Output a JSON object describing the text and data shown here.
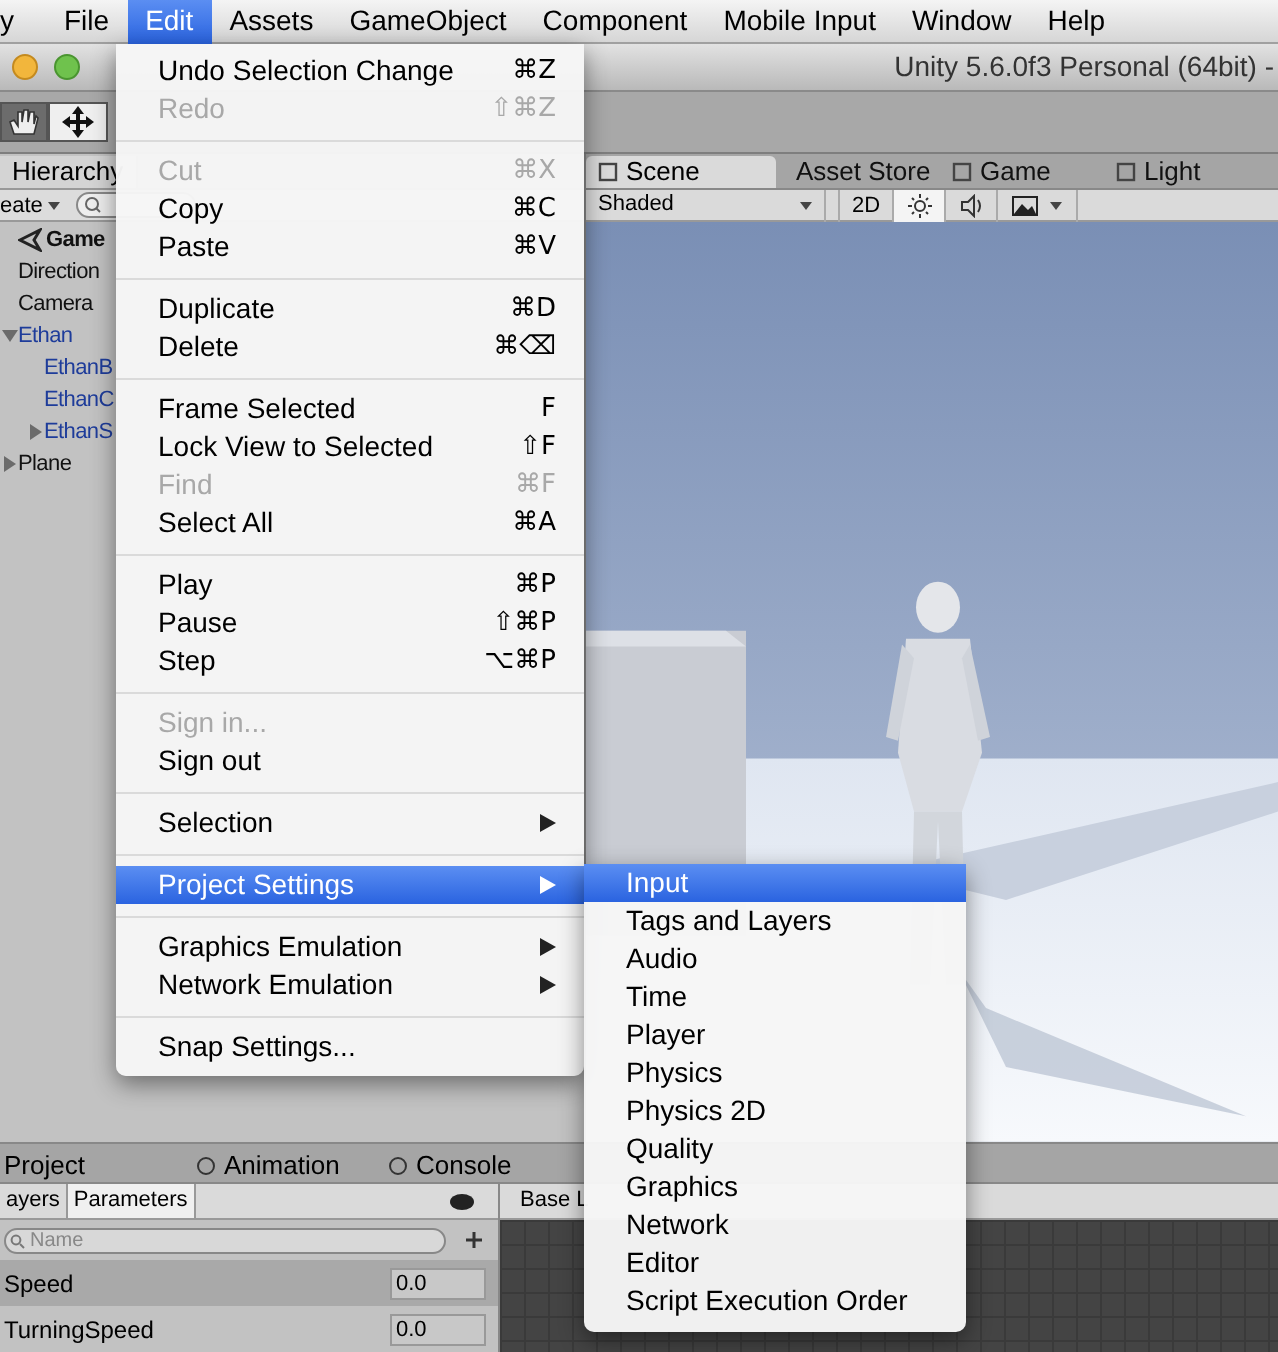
{
  "menubar": {
    "items": [
      {
        "label": "y",
        "selected": false
      },
      {
        "label": "File",
        "selected": false
      },
      {
        "label": "Edit",
        "selected": true
      },
      {
        "label": "Assets",
        "selected": false
      },
      {
        "label": "GameObject",
        "selected": false
      },
      {
        "label": "Component",
        "selected": false
      },
      {
        "label": "Mobile Input",
        "selected": false
      },
      {
        "label": "Window",
        "selected": false
      },
      {
        "label": "Help",
        "selected": false
      }
    ]
  },
  "window": {
    "title": "Unity 5.6.0f3 Personal (64bit) -"
  },
  "hierarchy": {
    "tab": "Hierarchy",
    "create_button": "eate",
    "tree": [
      {
        "label": "Game",
        "bold": true,
        "children": [
          {
            "label": "Direction"
          },
          {
            "label": "Camera"
          },
          {
            "label": "Ethan",
            "prefab": true,
            "expanded": true,
            "children": [
              {
                "label": "EthanB",
                "prefab": true
              },
              {
                "label": "EthanC",
                "prefab": true
              },
              {
                "label": "EthanS",
                "prefab": true,
                "expanded": false
              }
            ]
          },
          {
            "label": "Plane",
            "expanded": false
          }
        ]
      }
    ]
  },
  "scene": {
    "tabs": [
      {
        "label": "Scene",
        "selected": true
      },
      {
        "label": "Asset Store",
        "selected": false
      },
      {
        "label": "Game",
        "selected": false
      },
      {
        "label": "Light",
        "selected": false
      }
    ],
    "draw_mode": "Shaded",
    "mode_button": "2D"
  },
  "bottom": {
    "tabs": [
      {
        "label": "Project",
        "selected": false
      },
      {
        "label": "Animation",
        "selected": false
      },
      {
        "label": "Console",
        "selected": false
      }
    ],
    "sub_tabs": [
      {
        "label": "ayers",
        "selected": false
      },
      {
        "label": "Parameters",
        "selected": true
      }
    ],
    "search": {
      "placeholder": "Name"
    },
    "parameters": [
      {
        "name": "Speed",
        "value": "0.0",
        "selected": true
      },
      {
        "name": "TurningSpeed",
        "value": "0.0",
        "selected": false
      }
    ],
    "layer_tab": "Base L"
  },
  "edit_menu": {
    "items": [
      {
        "kind": "item",
        "label": "Undo Selection Change",
        "shortcut": "⌘Z",
        "disabled": false
      },
      {
        "kind": "item",
        "label": "Redo",
        "shortcut": "⇧⌘Z",
        "disabled": true
      },
      {
        "kind": "separator"
      },
      {
        "kind": "item",
        "label": "Cut",
        "shortcut": "⌘X",
        "disabled": true
      },
      {
        "kind": "item",
        "label": "Copy",
        "shortcut": "⌘C",
        "disabled": false
      },
      {
        "kind": "item",
        "label": "Paste",
        "shortcut": "⌘V",
        "disabled": false
      },
      {
        "kind": "separator"
      },
      {
        "kind": "item",
        "label": "Duplicate",
        "shortcut": "⌘D",
        "disabled": false
      },
      {
        "kind": "item",
        "label": "Delete",
        "shortcut": "⌘⌫",
        "disabled": false
      },
      {
        "kind": "separator"
      },
      {
        "kind": "item",
        "label": "Frame Selected",
        "shortcut": "F",
        "disabled": false
      },
      {
        "kind": "item",
        "label": "Lock View to Selected",
        "shortcut": "⇧F",
        "disabled": false
      },
      {
        "kind": "item",
        "label": "Find",
        "shortcut": "⌘F",
        "disabled": true
      },
      {
        "kind": "item",
        "label": "Select All",
        "shortcut": "⌘A",
        "disabled": false
      },
      {
        "kind": "separator"
      },
      {
        "kind": "item",
        "label": "Play",
        "shortcut": "⌘P",
        "disabled": false
      },
      {
        "kind": "item",
        "label": "Pause",
        "shortcut": "⇧⌘P",
        "disabled": false
      },
      {
        "kind": "item",
        "label": "Step",
        "shortcut": "⌥⌘P",
        "disabled": false
      },
      {
        "kind": "separator"
      },
      {
        "kind": "item",
        "label": "Sign in...",
        "disabled": true
      },
      {
        "kind": "item",
        "label": "Sign out",
        "disabled": false
      },
      {
        "kind": "separator"
      },
      {
        "kind": "submenu",
        "label": "Selection",
        "selected": false
      },
      {
        "kind": "separator"
      },
      {
        "kind": "submenu",
        "label": "Project Settings",
        "selected": true
      },
      {
        "kind": "separator"
      },
      {
        "kind": "submenu",
        "label": "Graphics Emulation",
        "selected": false
      },
      {
        "kind": "submenu",
        "label": "Network Emulation",
        "selected": false
      },
      {
        "kind": "separator"
      },
      {
        "kind": "item",
        "label": "Snap Settings...",
        "disabled": false
      }
    ]
  },
  "project_settings_menu": {
    "items": [
      {
        "label": "Input",
        "selected": true
      },
      {
        "label": "Tags and Layers",
        "selected": false
      },
      {
        "label": "Audio",
        "selected": false
      },
      {
        "label": "Time",
        "selected": false
      },
      {
        "label": "Player",
        "selected": false
      },
      {
        "label": "Physics",
        "selected": false
      },
      {
        "label": "Physics 2D",
        "selected": false
      },
      {
        "label": "Quality",
        "selected": false
      },
      {
        "label": "Graphics",
        "selected": false
      },
      {
        "label": "Network",
        "selected": false
      },
      {
        "label": "Editor",
        "selected": false
      },
      {
        "label": "Script Execution Order",
        "selected": false
      }
    ]
  }
}
